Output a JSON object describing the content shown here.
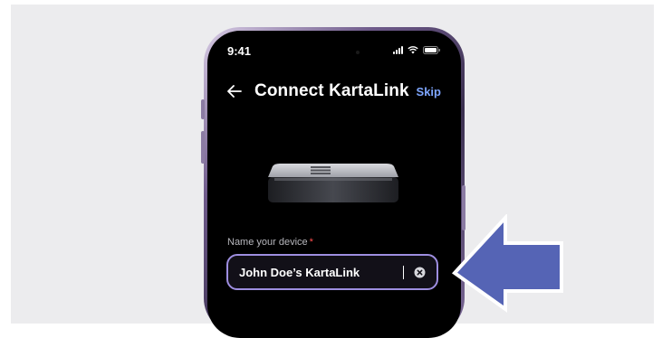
{
  "status_bar": {
    "time": "9:41"
  },
  "header": {
    "title": "Connect KartaLink",
    "skip_label": "Skip"
  },
  "form": {
    "label": "Name your device",
    "required_marker": "*",
    "value": "John Doe’s KartaLink"
  },
  "icons": {
    "back": "arrow-left-icon",
    "clear": "clear-circle-x-icon",
    "signal": "cellular-signal-icon",
    "wifi": "wifi-icon",
    "battery": "battery-icon"
  },
  "colors": {
    "accent_link": "#7ea6ff",
    "input_border": "#9e8ee0",
    "required": "#ff4d4d",
    "callout_arrow": "#5564b5"
  }
}
